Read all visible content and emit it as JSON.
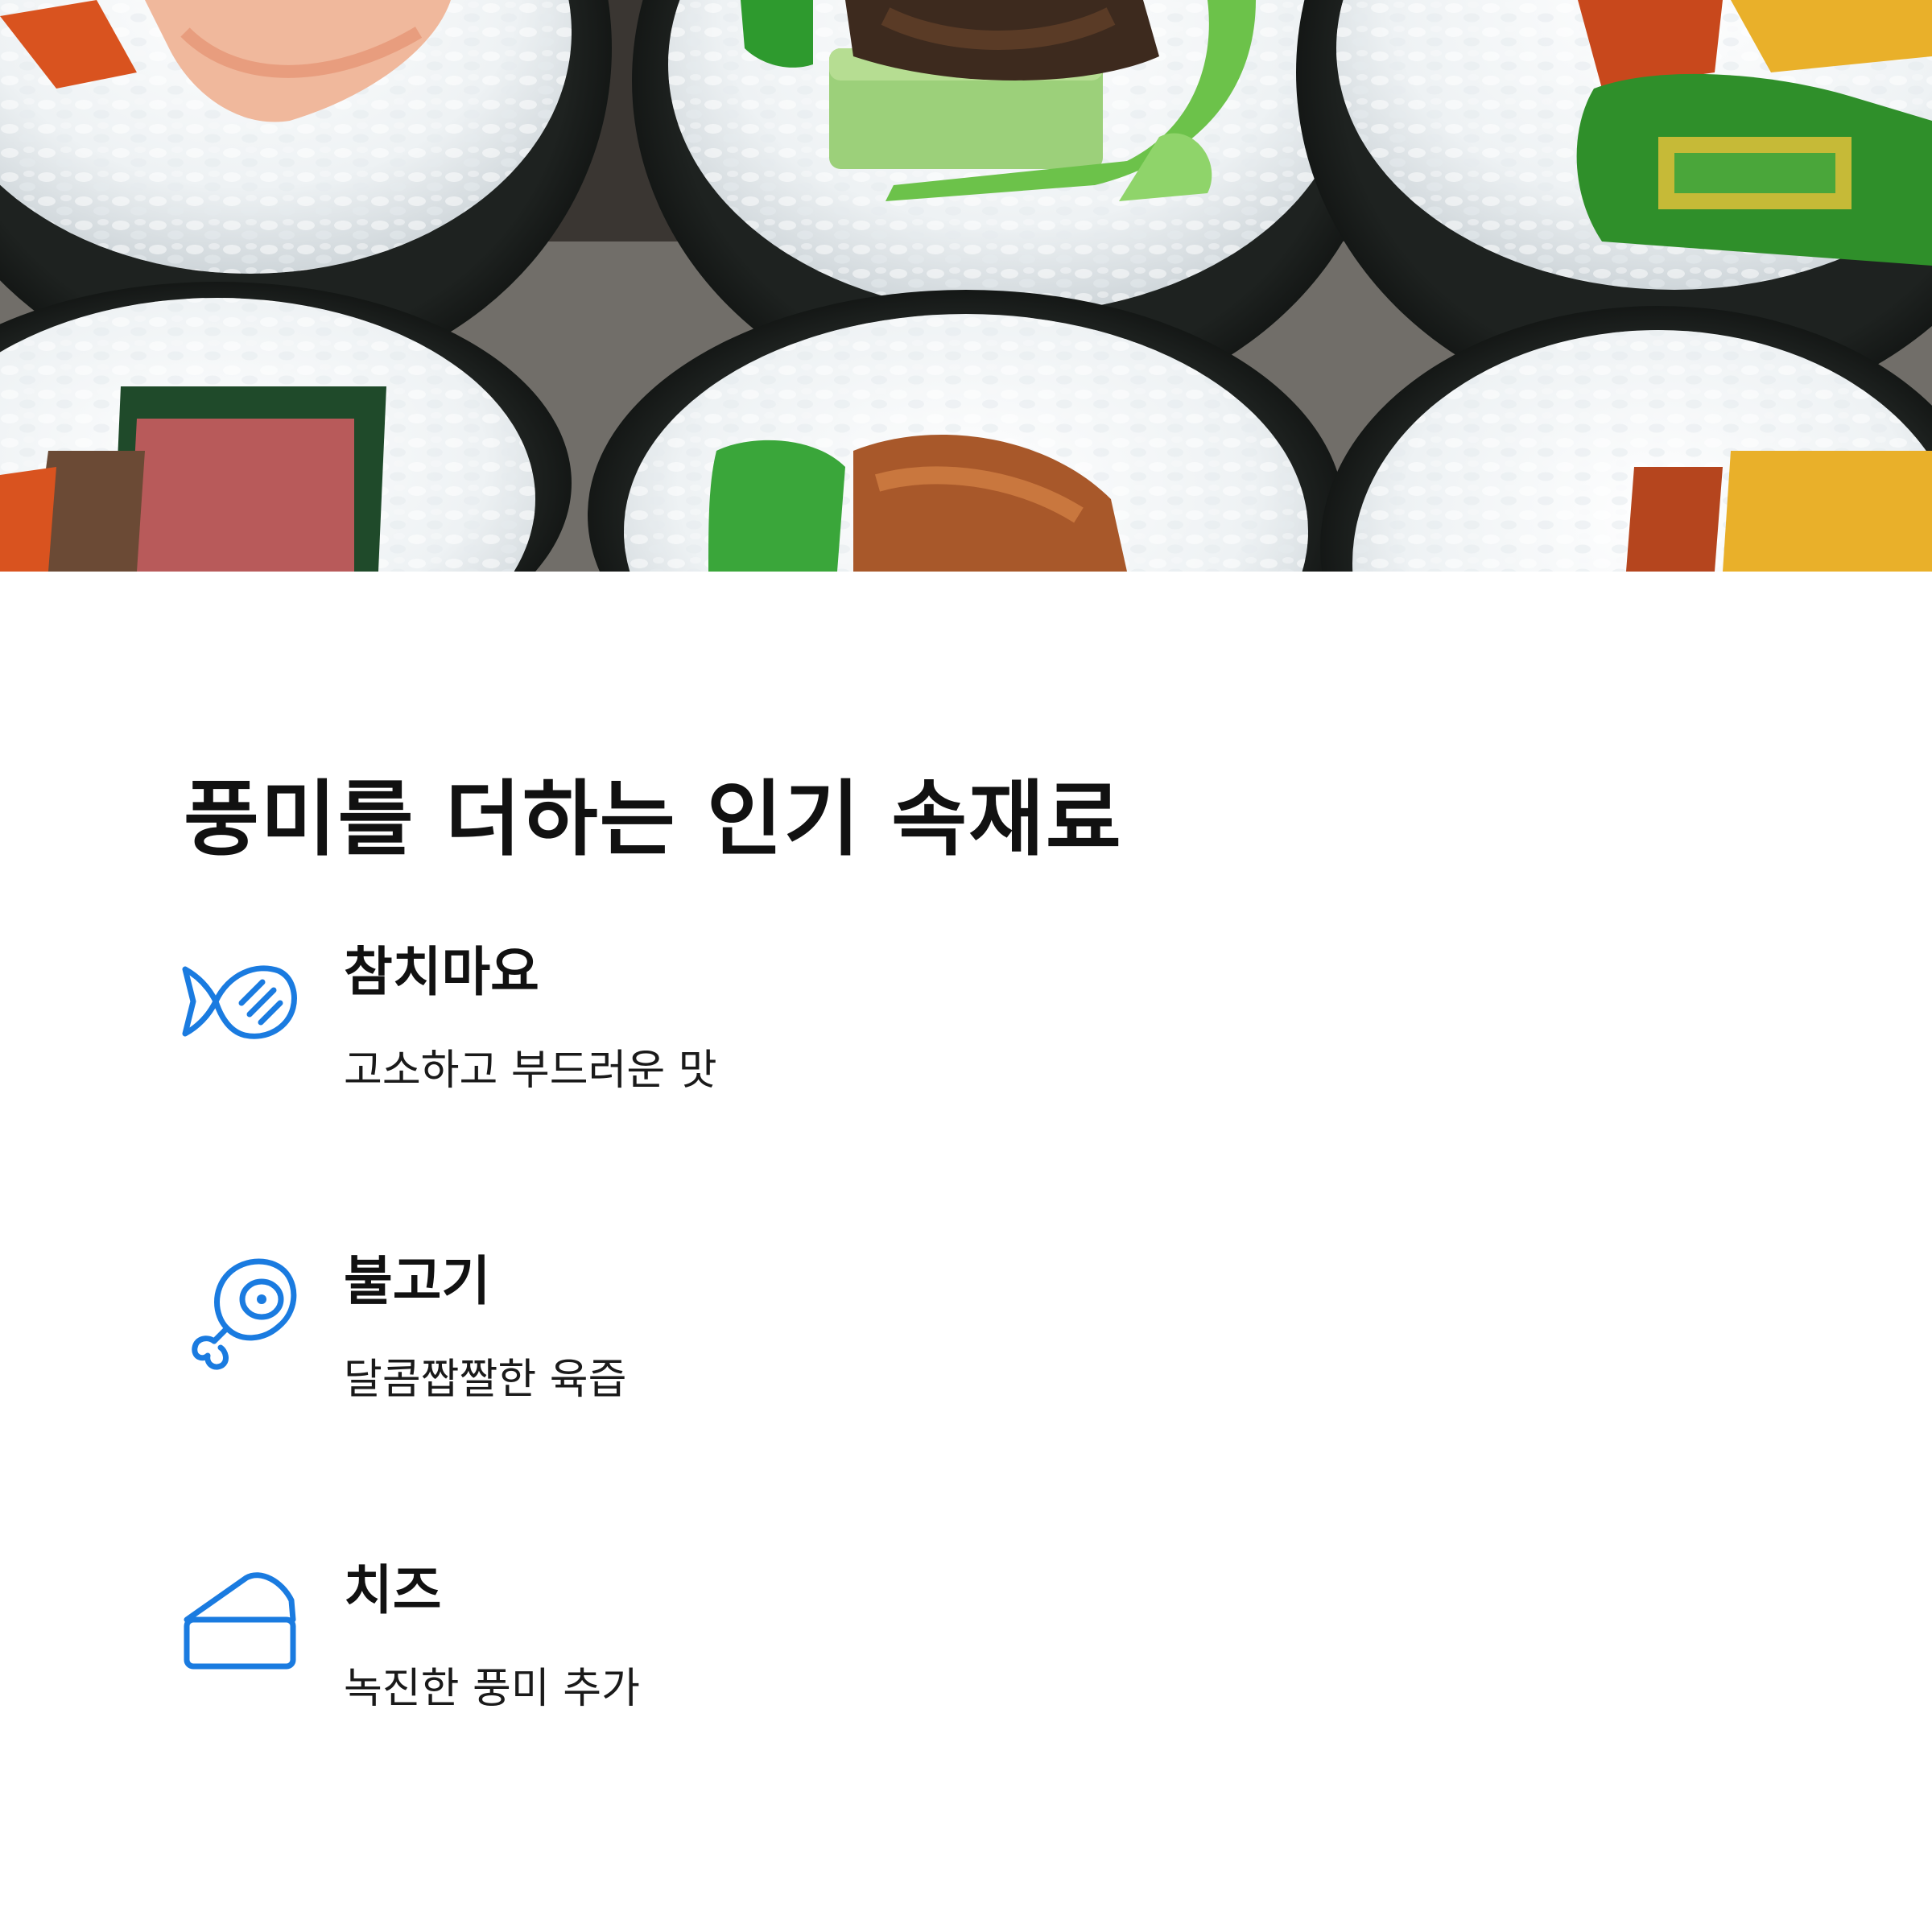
{
  "hero": {
    "subject": "kimbap slices close-up photo"
  },
  "section": {
    "title": "풍미를 더하는 인기 속재료"
  },
  "items": [
    {
      "icon": "fish-icon",
      "title": "참치마요",
      "desc": "고소하고 부드러운 맛"
    },
    {
      "icon": "meat-drumstick-icon",
      "title": "불고기",
      "desc": "달콤짭짤한 육즙"
    },
    {
      "icon": "cheese-icon",
      "title": "치즈",
      "desc": "녹진한 풍미 추가"
    }
  ],
  "colors": {
    "accent": "#1a7be0",
    "text": "#111111",
    "background": "#ffffff"
  }
}
